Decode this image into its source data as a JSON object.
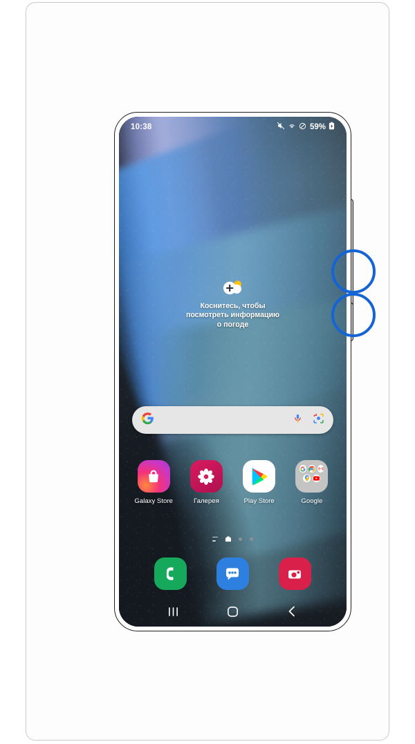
{
  "phone": {
    "status_bar": {
      "time": "10:38",
      "battery_percent": "59%",
      "icons": [
        "mute-icon",
        "wifi-icon",
        "do-not-disturb-icon",
        "battery-icon"
      ]
    },
    "weather_widget": {
      "icon": "cloud-plus-sun-icon",
      "text_line_1": "Коснитесь, чтобы",
      "text_line_2": "посмотреть информацию",
      "text_line_3": "о погоде",
      "text": "Коснитесь, чтобы посмотреть информацию о погоде"
    },
    "search_bar": {
      "logo": "google-g-icon",
      "placeholder": "",
      "value": "",
      "mic_icon": "microphone-icon",
      "lens_icon": "google-lens-camera-icon"
    },
    "apps": [
      {
        "label": "Galaxy Store",
        "icon": "galaxy-store-icon",
        "color": "#e4399b"
      },
      {
        "label": "Галерея",
        "icon": "gallery-flower-icon",
        "color": "#c2185b"
      },
      {
        "label": "Play Store",
        "icon": "play-store-icon",
        "color": "#ffffff"
      },
      {
        "label": "Google",
        "icon": "google-folder-icon",
        "color": "#c4c4c4"
      }
    ],
    "folder_apps": [
      "google-icon",
      "chrome-icon",
      "gmail-icon",
      "maps-icon",
      "youtube-icon"
    ],
    "page_indicator": {
      "items": [
        "daily-lines-icon",
        "home-page-active",
        "page-dot",
        "page-dot"
      ],
      "active_index": 1
    },
    "dock": [
      {
        "label": "Phone",
        "icon": "phone-icon",
        "color": "#17a95b"
      },
      {
        "label": "Messages",
        "icon": "messages-icon",
        "color": "#2d7fe0"
      },
      {
        "label": "Camera",
        "icon": "camera-icon",
        "color": "#d8204a"
      }
    ],
    "nav_bar": [
      {
        "label": "Recents",
        "icon": "recents-icon"
      },
      {
        "label": "Home",
        "icon": "home-icon"
      },
      {
        "label": "Back",
        "icon": "back-icon"
      }
    ],
    "side_buttons": [
      {
        "label": "Volume",
        "name": "volume-rocker"
      },
      {
        "label": "Power",
        "name": "power-button"
      }
    ]
  },
  "annotations": {
    "color": "#1564d6",
    "circles": [
      {
        "target": "volume-rocker"
      },
      {
        "target": "power-button"
      }
    ]
  }
}
